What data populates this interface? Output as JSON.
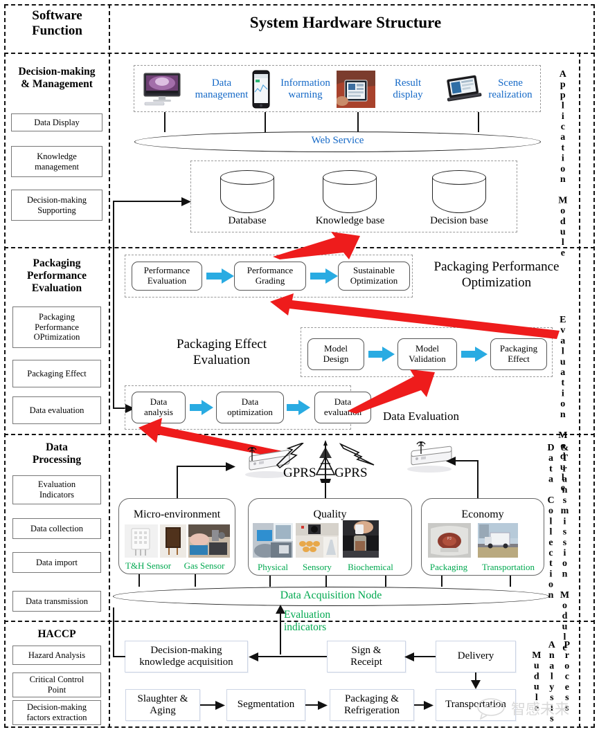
{
  "header": {
    "left_title": "Software\nFunction",
    "left_title_line1": "Software",
    "left_title_line2": "Function",
    "main_title": "System Hardware Structure"
  },
  "sections": [
    {
      "id": "application",
      "left_title_line1": "Decision-making",
      "left_title_line2": "& Management",
      "module_label": "Application Module",
      "left_boxes": [
        "Data Display",
        "Knowledge\nmanagement",
        "Decision-making\nSupporting"
      ],
      "app_items": [
        {
          "label_line1": "Data",
          "label_line2": "management",
          "icon": "desktop-monitor-icon"
        },
        {
          "label_line1": "Information",
          "label_line2": "warning",
          "icon": "smartphone-icon"
        },
        {
          "label_line1": "Result",
          "label_line2": "display",
          "icon": "tablet-photo-icon"
        },
        {
          "label_line1": "Scene",
          "label_line2": "realization",
          "icon": "laptop-icon"
        }
      ],
      "bus_label": "Web Service",
      "stores": [
        "Database",
        "Knowledge base",
        "Decision base"
      ]
    },
    {
      "id": "evaluation",
      "left_title_line1": "Packaging",
      "left_title_line2": "Performance",
      "left_title_line3": "Evaluation",
      "module_label": "Evaluation Module",
      "left_boxes": [
        "Packaging\nPerformance\nOPtimization",
        "Packaging Effect",
        "Data evaluation"
      ],
      "group_titles": {
        "performance": "Packaging Performance\nOptimization",
        "effect": "Packaging Effect\nEvaluation",
        "data": "Data Evaluation"
      },
      "flow_performance": [
        "Performance\nEvaluation",
        "Performance\nGrading",
        "Sustainable\nOptimization"
      ],
      "flow_model": [
        "Model\nDesign",
        "Model\nValidation",
        "Packaging\nEffect"
      ],
      "flow_data": [
        "Data\nanalysis",
        "Data\noptimization",
        "Data\nevaluation"
      ]
    },
    {
      "id": "collection",
      "left_title_line1": "Data",
      "left_title_line2": "Processing",
      "module_label_line1": "Data Collection",
      "module_label_line2": "&Transmission  Module",
      "left_boxes": [
        "Evaluation\nIndicators",
        "Data collection",
        "Data import",
        "Data transmission"
      ],
      "gprs_labels": [
        "GPRS",
        "GPRS"
      ],
      "cards": [
        {
          "title": "Micro-environment",
          "items": [
            {
              "label": "T&H Sensor",
              "icon": "temp-humidity-sensor-photo"
            },
            {
              "label": "",
              "icon": "sensor-board-photo"
            },
            {
              "label": "Gas Sensor",
              "icon": "gas-sensor-photo"
            }
          ]
        },
        {
          "title": "Quality",
          "items": [
            {
              "label": "Physical",
              "icon": "physical-test-photo"
            },
            {
              "label": "Sensory",
              "icon": "sensory-test-photo"
            },
            {
              "label": "Biochemical",
              "icon": "biochemical-test-photo"
            }
          ]
        },
        {
          "title": "Economy",
          "items": [
            {
              "label": "Packaging",
              "icon": "packaged-meat-photo"
            },
            {
              "label": "Transportation",
              "icon": "truck-photo"
            }
          ]
        }
      ],
      "bus_label": "Data Acquisition Node",
      "uplink_label_line1": "Evaluation",
      "uplink_label_line2": "indicators"
    },
    {
      "id": "process",
      "left_title": "HACCP",
      "module_label_line1": "Process",
      "module_label_line2": "Analysis",
      "module_label_line3": "Mudule",
      "left_boxes": [
        "Hazard Analysis",
        "Critical Control\nPoint",
        "Decision-making\nfactors extraction"
      ],
      "flow_top": [
        "Decision-making\nknowledge acquisition",
        "Sign &\nReceipt",
        "Delivery"
      ],
      "flow_bottom": [
        "Slaughter &\nAging",
        "Segmentation",
        "Packaging &\nRefrigeration",
        "Transportation"
      ]
    }
  ],
  "watermark": "智感未来",
  "colors": {
    "blue_text": "#1569C7",
    "green_text": "#00a84f",
    "red_arrow": "#ee1c1c",
    "blue_arrow": "#29ABE2",
    "line": "#111111"
  }
}
